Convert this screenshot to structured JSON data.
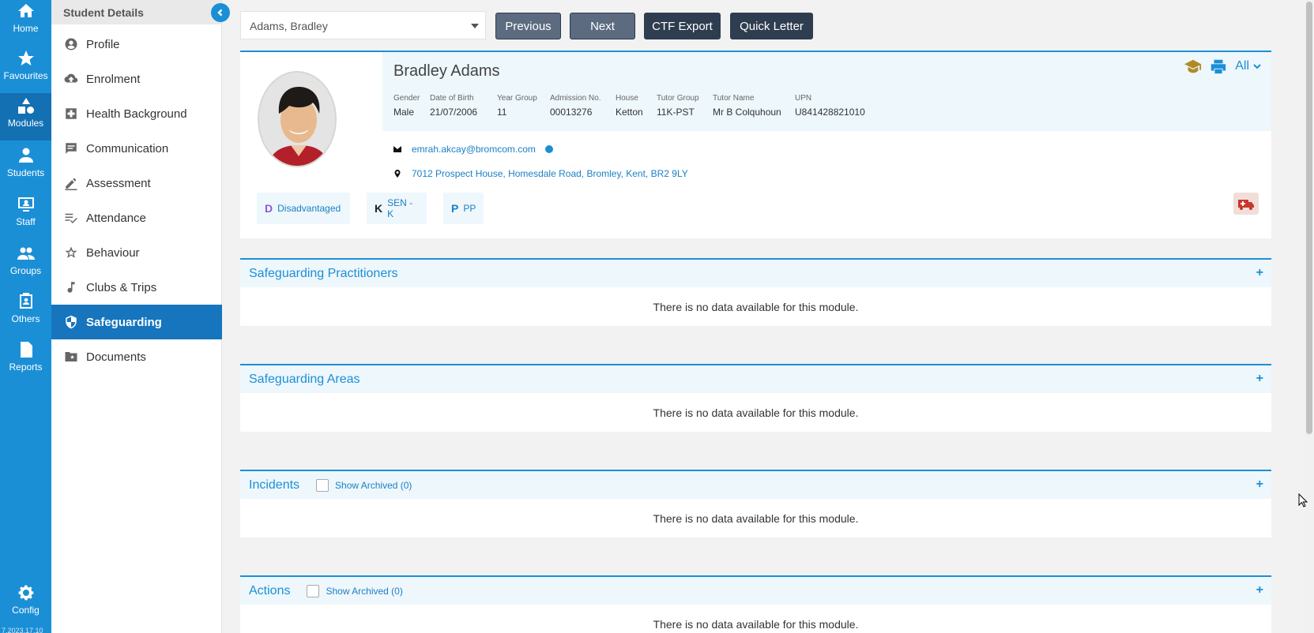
{
  "rail": {
    "items": [
      {
        "label": "Home",
        "icon": "home-icon"
      },
      {
        "label": "Favourites",
        "icon": "star-icon"
      },
      {
        "label": "Modules",
        "icon": "modules-icon",
        "active": true
      },
      {
        "label": "Students",
        "icon": "person-icon"
      },
      {
        "label": "Staff",
        "icon": "staff-icon"
      },
      {
        "label": "Groups",
        "icon": "groups-icon"
      },
      {
        "label": "Others",
        "icon": "contact-card-icon"
      },
      {
        "label": "Reports",
        "icon": "report-icon"
      }
    ],
    "config_label": "Config",
    "version": "7.2023.17.10"
  },
  "sidebar": {
    "title": "Student Details",
    "items": [
      {
        "label": "Profile",
        "icon": "profile-icon"
      },
      {
        "label": "Enrolment",
        "icon": "cloud-upload-icon"
      },
      {
        "label": "Health Background",
        "icon": "medical-plus-icon"
      },
      {
        "label": "Communication",
        "icon": "comment-icon"
      },
      {
        "label": "Assessment",
        "icon": "pen-icon"
      },
      {
        "label": "Attendance",
        "icon": "checklist-icon"
      },
      {
        "label": "Behaviour",
        "icon": "star-outline-icon"
      },
      {
        "label": "Clubs & Trips",
        "icon": "music-note-icon"
      },
      {
        "label": "Safeguarding",
        "icon": "shield-icon",
        "active": true
      },
      {
        "label": "Documents",
        "icon": "folder-star-icon"
      }
    ]
  },
  "toolbar": {
    "student_select": "Adams, Bradley",
    "previous_label": "Previous",
    "next_label": "Next",
    "ctf_export_label": "CTF Export",
    "quick_letter_label": "Quick Letter"
  },
  "student": {
    "name": "Bradley Adams",
    "fields": [
      {
        "label": "Gender",
        "value": "Male"
      },
      {
        "label": "Date of Birth",
        "value": "21/07/2006"
      },
      {
        "label": "Year Group",
        "value": "11"
      },
      {
        "label": "Admission No.",
        "value": "00013276"
      },
      {
        "label": "House",
        "value": "Ketton"
      },
      {
        "label": "Tutor Group",
        "value": "11K-PST"
      },
      {
        "label": "Tutor Name",
        "value": "Mr B Colquhoun"
      },
      {
        "label": "UPN",
        "value": "U841428821010"
      }
    ],
    "email": "emrah.akcay@bromcom.com",
    "address": "7012 Prospect House, Homesdale Road, Bromley, Kent, BR2 9LY",
    "flags": [
      {
        "letter": "D",
        "label": "Disadvantaged",
        "color": "#8a5bd6"
      },
      {
        "letter": "K",
        "label": "SEN - K",
        "color": "#222222"
      },
      {
        "letter": "P",
        "label": "PP",
        "color": "#1b7fc4"
      }
    ],
    "view_filter": "All"
  },
  "modules": [
    {
      "title": "Safeguarding Practitioners",
      "message": "There is no data available for this module."
    },
    {
      "title": "Safeguarding Areas",
      "message": "There is no data available for this module."
    },
    {
      "title": "Incidents",
      "archived_label": "Show Archived (0)",
      "message": "There is no data available for this module."
    },
    {
      "title": "Actions",
      "archived_label": "Show Archived (0)",
      "message": "There is no data available for this module."
    }
  ],
  "colors": {
    "accent": "#1b8fd6",
    "active_nav": "#1675bd"
  }
}
